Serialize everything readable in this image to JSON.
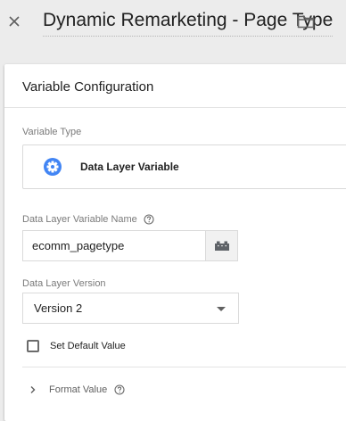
{
  "header": {
    "close_icon": "close-icon",
    "title": "Dynamic Remarketing - Page Type",
    "folder_icon": "folder-icon"
  },
  "card": {
    "title": "Variable Configuration",
    "variable_type": {
      "label": "Variable Type",
      "icon": "gear-icon",
      "icon_color": "#4285f4",
      "name": "Data Layer Variable"
    },
    "data_layer_variable_name": {
      "label": "Data Layer Variable Name",
      "help_icon": "help-icon",
      "value": "ecomm_pagetype",
      "picker_icon": "variable-picker-icon"
    },
    "data_layer_version": {
      "label": "Data Layer Version",
      "selected": "Version 2"
    },
    "set_default_value": {
      "label": "Set Default Value",
      "checked": false
    },
    "format_value": {
      "label": "Format Value",
      "help_icon": "help-icon",
      "expanded": false
    }
  }
}
